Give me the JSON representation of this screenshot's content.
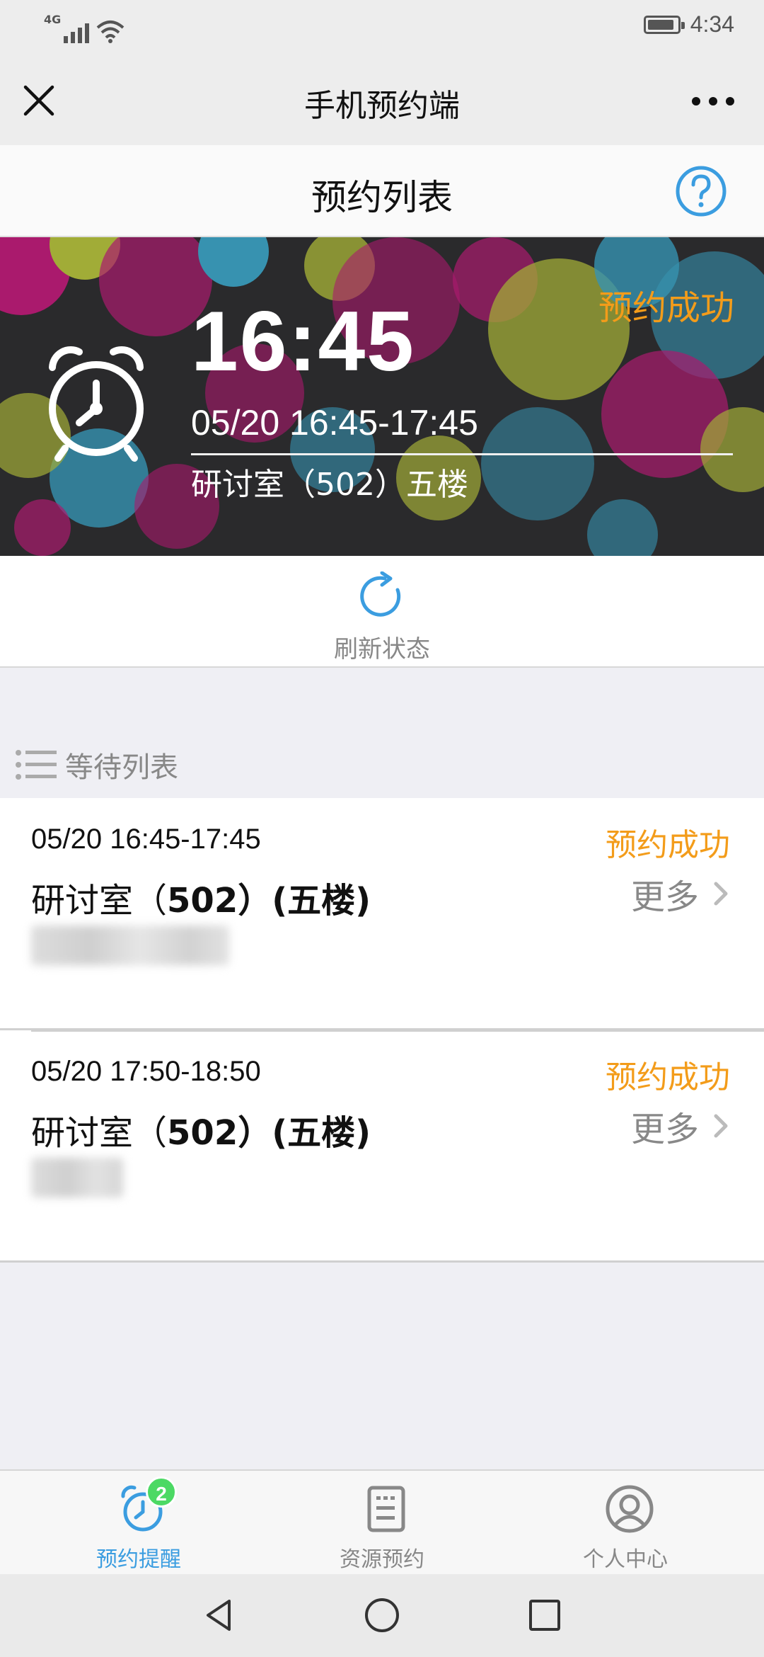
{
  "status_bar": {
    "network": "4G",
    "time": "4:34",
    "battery_level": 0.9
  },
  "nav": {
    "title": "手机预约端",
    "close_icon": "close-icon",
    "more_icon": "more-dots-icon"
  },
  "sub_header": {
    "title": "预约列表",
    "help_icon": "help-circle-icon"
  },
  "banner": {
    "time": "16:45",
    "status": "预约成功",
    "range": "05/20 16:45-17:45",
    "room": "研讨室（502）五楼",
    "status_color": "#f39c1a"
  },
  "refresh": {
    "label": "刷新状态"
  },
  "waiting_list": {
    "label": "等待列表",
    "items": [
      {
        "time": "05/20 16:45-17:45",
        "status": "预约成功",
        "room_prefix": "研讨室（",
        "room_number": "502",
        "room_suffix": "）(五楼)",
        "more": "更多"
      },
      {
        "time": "05/20 17:50-18:50",
        "status": "预约成功",
        "room_prefix": "研讨室（",
        "room_number": "502",
        "room_suffix": "）(五楼)",
        "more": "更多"
      }
    ]
  },
  "tab_bar": {
    "tabs": [
      {
        "label": "预约提醒",
        "icon": "alarm-icon",
        "badge": "2",
        "active": true
      },
      {
        "label": "资源预约",
        "icon": "document-icon",
        "active": false
      },
      {
        "label": "个人中心",
        "icon": "user-icon",
        "active": false
      }
    ]
  },
  "colors": {
    "accent": "#3b9de0",
    "success_status": "#f39c1a",
    "badge": "#4cd964"
  }
}
